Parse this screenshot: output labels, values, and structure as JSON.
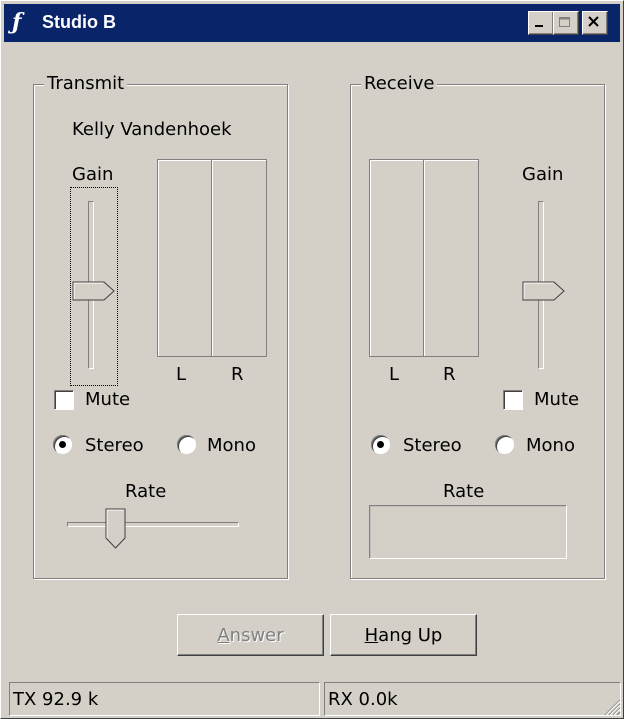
{
  "window": {
    "title": "Studio B",
    "icon": "app-logo-icon"
  },
  "transmit": {
    "group_label": "Transmit",
    "caller_name": "Kelly Vandenhoek",
    "gain_label": "Gain",
    "gain_level": 0.45,
    "meter_left_label": "L",
    "meter_right_label": "R",
    "mute_label": "Mute",
    "mute_checked": false,
    "stereo_label": "Stereo",
    "mono_label": "Mono",
    "mode": "Stereo",
    "rate_label": "Rate",
    "rate_level": 0.25
  },
  "receive": {
    "group_label": "Receive",
    "gain_label": "Gain",
    "gain_level": 0.45,
    "meter_left_label": "L",
    "meter_right_label": "R",
    "mute_label": "Mute",
    "mute_checked": false,
    "stereo_label": "Stereo",
    "mono_label": "Mono",
    "mode": "Stereo",
    "rate_label": "Rate"
  },
  "buttons": {
    "answer_label": "Answer",
    "answer_accesskey": "A",
    "answer_rest": "nswer",
    "hangup_label": "Hang Up",
    "hangup_accesskey": "H",
    "hangup_rest": "ang Up"
  },
  "status": {
    "tx": "TX 92.9 k",
    "rx": "RX 0.0k"
  },
  "colors": {
    "titlebar": "#0a246a",
    "face": "#d4d0c8",
    "disabled_text": "#808080"
  }
}
